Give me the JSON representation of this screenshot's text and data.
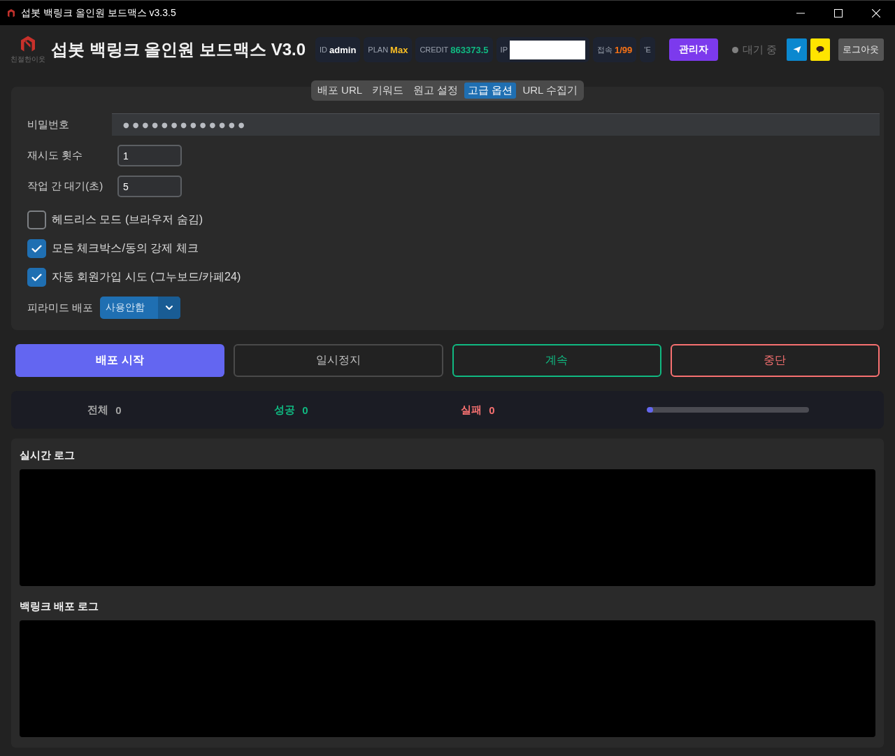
{
  "window": {
    "title": "섭봇 백링크 올인원 보드맥스 v3.3.5"
  },
  "header": {
    "logo_caption": "친절한이웃",
    "title": "섭봇 백링크 올인원 보드맥스 V3.0",
    "badges": [
      {
        "kind": "value",
        "label": "ID",
        "value": "admin",
        "color": "#ffffff"
      },
      {
        "kind": "value",
        "label": "PLAN",
        "value": "Max",
        "color": "#fbbf24"
      },
      {
        "kind": "value",
        "label": "CREDIT",
        "value": "863373.5",
        "color": "#10b981"
      },
      {
        "kind": "redacted",
        "label": "IP"
      },
      {
        "kind": "value",
        "label": "접속",
        "value": "1/99",
        "color": "#f97316"
      },
      {
        "kind": "label",
        "label": "'E"
      }
    ],
    "admin_button": "관리자",
    "status": {
      "label": "대기 중",
      "color": "#808080"
    },
    "logout_button": "로그아웃"
  },
  "tabs": [
    {
      "label": "배포 URL",
      "selected": false
    },
    {
      "label": "키워드",
      "selected": false
    },
    {
      "label": "원고 설정",
      "selected": false
    },
    {
      "label": "고급 옵션",
      "selected": true
    },
    {
      "label": "URL 수집기",
      "selected": false
    }
  ],
  "settings": {
    "password": {
      "label": "비밀번호",
      "value": "●●●●●●●●●●●●●"
    },
    "fields": [
      {
        "label": "재시도 횟수",
        "value": "1"
      },
      {
        "label": "작업 간 대기(초)",
        "value": "5"
      }
    ],
    "checkboxes": [
      {
        "label": "헤드리스 모드 (브라우저 숨김)",
        "checked": false
      },
      {
        "label": "모든 체크박스/동의 강제 체크",
        "checked": true
      },
      {
        "label": "자동 회원가입 시도 (그누보드/카페24)",
        "checked": true
      }
    ],
    "pyramid": {
      "label": "피라미드 배포",
      "value": "사용안함"
    }
  },
  "actions": [
    {
      "kind": "primary",
      "label": "배포 시작"
    },
    {
      "kind": "neutral",
      "label": "일시정지"
    },
    {
      "kind": "success",
      "label": "계속"
    },
    {
      "kind": "danger",
      "label": "중단"
    }
  ],
  "stats": {
    "items": [
      {
        "label": "전체",
        "value": "0",
        "color": "#a3a3a3"
      },
      {
        "label": "성공",
        "value": "0",
        "color": "#10b981"
      },
      {
        "label": "실패",
        "value": "0",
        "color": "#f87171"
      }
    ],
    "progress": {
      "level": 0.04
    }
  },
  "logs": [
    {
      "title": "실시간 로그"
    },
    {
      "title": "백링크 배포 로그"
    }
  ]
}
